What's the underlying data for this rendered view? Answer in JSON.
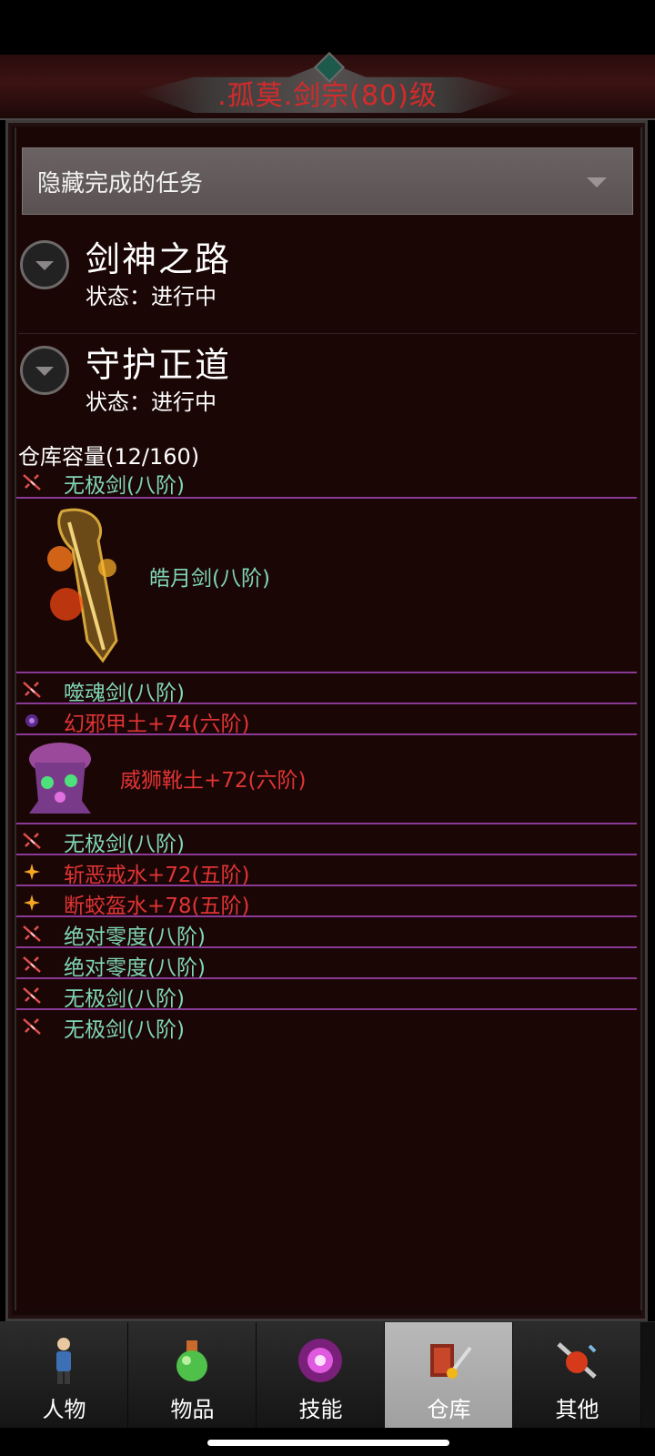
{
  "header": {
    "title": ".孤莫.剑宗(80)级"
  },
  "filter": {
    "label": "隐藏完成的任务"
  },
  "quests": [
    {
      "name": "剑神之路",
      "status": "状态：进行中"
    },
    {
      "name": "守护正道",
      "status": "状态：进行中"
    }
  ],
  "warehouse": {
    "capacity": "仓库容量(12/160)",
    "items": [
      {
        "name": "无极剑(八阶)",
        "color": "#7fd6b4",
        "icon": "sword-icon"
      },
      {
        "name": "皓月剑(八阶)",
        "color": "#7fd6b4",
        "icon": "flaming-sword-icon"
      },
      {
        "name": "噬魂剑(八阶)",
        "color": "#7fd6b4",
        "icon": "sword-icon"
      },
      {
        "name": "幻邪甲土+74(六阶)",
        "color": "#e03434",
        "icon": "armor-icon"
      },
      {
        "name": "威狮靴土+72(六阶)",
        "color": "#e03434",
        "icon": "boots-icon"
      },
      {
        "name": "无极剑(八阶)",
        "color": "#7fd6b4",
        "icon": "sword-icon"
      },
      {
        "name": "斩恶戒水+72(五阶)",
        "color": "#e03434",
        "icon": "ring-icon"
      },
      {
        "name": "断蛟盔水+78(五阶)",
        "color": "#e03434",
        "icon": "helmet-icon"
      },
      {
        "name": "绝对零度(八阶)",
        "color": "#7fd6b4",
        "icon": "sword-icon"
      },
      {
        "name": "绝对零度(八阶)",
        "color": "#7fd6b4",
        "icon": "sword-icon"
      },
      {
        "name": "无极剑(八阶)",
        "color": "#7fd6b4",
        "icon": "sword-icon"
      },
      {
        "name": "无极剑(八阶)",
        "color": "#7fd6b4",
        "icon": "sword-icon"
      }
    ]
  },
  "tabs": [
    {
      "label": "人物",
      "icon": "character-icon"
    },
    {
      "label": "物品",
      "icon": "potion-icon"
    },
    {
      "label": "技能",
      "icon": "skill-icon"
    },
    {
      "label": "仓库",
      "icon": "warehouse-icon",
      "active": true
    },
    {
      "label": "其他",
      "icon": "other-icon"
    }
  ]
}
